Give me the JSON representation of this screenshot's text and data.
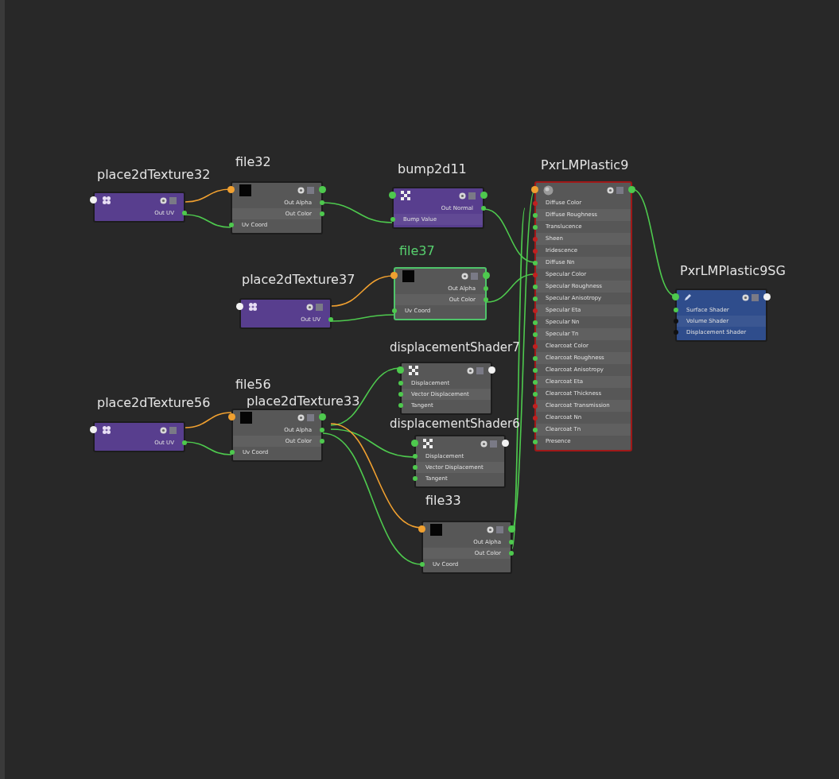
{
  "nodes": [
    {
      "title": "place2dTexture32",
      "kind": "place2d",
      "selected": false,
      "header_ports": [
        {
          "kind": "in",
          "color": "#f2f2f2"
        }
      ],
      "ports": [
        {
          "label": "Out UV",
          "kind": "out",
          "color": "#4ec94e"
        }
      ]
    },
    {
      "title": "file32",
      "kind": "file",
      "selected": false,
      "header_ports": [
        {
          "kind": "in",
          "color": "#f0a030"
        },
        {
          "kind": "out",
          "color": "#4ec94e"
        }
      ],
      "ports": [
        {
          "label": "Out Alpha",
          "kind": "out",
          "color": "#4ec94e"
        },
        {
          "label": "Out Color",
          "kind": "out",
          "color": "#4ec94e"
        },
        {
          "label": "Uv Coord",
          "kind": "in",
          "color": "#4ec94e"
        }
      ]
    },
    {
      "title": "bump2d11",
      "kind": "bump",
      "selected": false,
      "header_ports": [
        {
          "kind": "in",
          "color": "#4ec94e"
        },
        {
          "kind": "out",
          "color": "#4ec94e"
        }
      ],
      "ports": [
        {
          "label": "Out Normal",
          "kind": "out",
          "color": "#4ec94e"
        },
        {
          "label": "Bump Value",
          "kind": "in",
          "color": "#4ec94e"
        }
      ]
    },
    {
      "title": "PxrLMPlastic9",
      "kind": "shader",
      "selected": false,
      "error": true,
      "header_ports": [
        {
          "kind": "in",
          "color": "#f0a030"
        },
        {
          "kind": "out",
          "color": "#4ec94e"
        }
      ],
      "ports": [
        {
          "label": "Diffuse Color",
          "kind": "in",
          "color": "#c02020"
        },
        {
          "label": "Diffuse Roughness",
          "kind": "in",
          "color": "#4ec94e"
        },
        {
          "label": "Translucence",
          "kind": "in",
          "color": "#4ec94e"
        },
        {
          "label": "Sheen",
          "kind": "in",
          "color": "#c02020"
        },
        {
          "label": "Iridescence",
          "kind": "in",
          "color": "#c02020"
        },
        {
          "label": "Diffuse Nn",
          "kind": "in",
          "color": "#4ec94e"
        },
        {
          "label": "Specular Color",
          "kind": "in",
          "color": "#c02020"
        },
        {
          "label": "Specular Roughness",
          "kind": "in",
          "color": "#4ec94e"
        },
        {
          "label": "Specular Anisotropy",
          "kind": "in",
          "color": "#4ec94e"
        },
        {
          "label": "Specular Eta",
          "kind": "in",
          "color": "#c02020"
        },
        {
          "label": "Specular Nn",
          "kind": "in",
          "color": "#4ec94e"
        },
        {
          "label": "Specular Tn",
          "kind": "in",
          "color": "#4ec94e"
        },
        {
          "label": "Clearcoat Color",
          "kind": "in",
          "color": "#c02020"
        },
        {
          "label": "Clearcoat Roughness",
          "kind": "in",
          "color": "#4ec94e"
        },
        {
          "label": "Clearcoat Anisotropy",
          "kind": "in",
          "color": "#4ec94e"
        },
        {
          "label": "Clearcoat Eta",
          "kind": "in",
          "color": "#4ec94e"
        },
        {
          "label": "Clearcoat Thickness",
          "kind": "in",
          "color": "#4ec94e"
        },
        {
          "label": "Clearcoat Transmission",
          "kind": "in",
          "color": "#c02020"
        },
        {
          "label": "Clearcoat Nn",
          "kind": "in",
          "color": "#c02020"
        },
        {
          "label": "Clearcoat Tn",
          "kind": "in",
          "color": "#4ec94e"
        },
        {
          "label": "Presence",
          "kind": "in",
          "color": "#4ec94e"
        }
      ]
    },
    {
      "title": "place2dTexture37",
      "kind": "place2d",
      "selected": false,
      "header_ports": [
        {
          "kind": "in",
          "color": "#f2f2f2"
        }
      ],
      "ports": [
        {
          "label": "Out UV",
          "kind": "out",
          "color": "#4ec94e"
        }
      ]
    },
    {
      "title": "file37",
      "kind": "file",
      "selected": true,
      "header_ports": [
        {
          "kind": "in",
          "color": "#f0a030"
        },
        {
          "kind": "out",
          "color": "#4ec94e"
        }
      ],
      "ports": [
        {
          "label": "Out Alpha",
          "kind": "out",
          "color": "#4ec94e"
        },
        {
          "label": "Out Color",
          "kind": "out",
          "color": "#4ec94e"
        },
        {
          "label": "Uv Coord",
          "kind": "in",
          "color": "#4ec94e"
        }
      ]
    },
    {
      "title": "PxrLMPlastic9SG",
      "kind": "sg",
      "selected": false,
      "header_ports": [
        {
          "kind": "in",
          "color": "#4ec94e"
        },
        {
          "kind": "out",
          "color": "#f2f2f2"
        }
      ],
      "ports": [
        {
          "label": "Surface Shader",
          "kind": "in",
          "color": "#4ec94e"
        },
        {
          "label": "Volume Shader",
          "kind": "in",
          "color": "#111111"
        },
        {
          "label": "Displacement Shader",
          "kind": "in",
          "color": "#111111"
        }
      ]
    },
    {
      "title": "displacementShader7",
      "kind": "displacement",
      "selected": false,
      "header_ports": [
        {
          "kind": "in",
          "color": "#4ec94e"
        },
        {
          "kind": "out",
          "color": "#f2f2f2"
        }
      ],
      "ports": [
        {
          "label": "Displacement",
          "kind": "in",
          "color": "#4ec94e"
        },
        {
          "label": "Vector Displacement",
          "kind": "in",
          "color": "#4ec94e"
        },
        {
          "label": "Tangent",
          "kind": "in",
          "color": "#4ec94e"
        }
      ]
    },
    {
      "title": "place2dTexture56",
      "kind": "place2d",
      "selected": false,
      "header_ports": [
        {
          "kind": "in",
          "color": "#f2f2f2"
        }
      ],
      "ports": [
        {
          "label": "Out UV",
          "kind": "out",
          "color": "#4ec94e"
        }
      ]
    },
    {
      "title": "file56",
      "kind": "file",
      "selected": false,
      "header_ports": [
        {
          "kind": "in",
          "color": "#f0a030"
        },
        {
          "kind": "out",
          "color": "#4ec94e"
        }
      ],
      "ports": [
        {
          "label": "Out Alpha",
          "kind": "out",
          "color": "#4ec94e"
        },
        {
          "label": "Out Color",
          "kind": "out",
          "color": "#4ec94e"
        },
        {
          "label": "Uv Coord",
          "kind": "in",
          "color": "#4ec94e"
        }
      ]
    },
    {
      "title": "place2dTexture33",
      "kind": "label",
      "selected": false
    },
    {
      "title": "displacementShader6",
      "kind": "displacement",
      "selected": false,
      "header_ports": [
        {
          "kind": "in",
          "color": "#4ec94e"
        },
        {
          "kind": "out",
          "color": "#f2f2f2"
        }
      ],
      "ports": [
        {
          "label": "Displacement",
          "kind": "in",
          "color": "#4ec94e"
        },
        {
          "label": "Vector Displacement",
          "kind": "in",
          "color": "#4ec94e"
        },
        {
          "label": "Tangent",
          "kind": "in",
          "color": "#4ec94e"
        }
      ]
    },
    {
      "title": "file33",
      "kind": "file",
      "selected": false,
      "header_ports": [
        {
          "kind": "in",
          "color": "#f0a030"
        },
        {
          "kind": "out",
          "color": "#4ec94e"
        }
      ],
      "ports": [
        {
          "label": "Out Alpha",
          "kind": "out",
          "color": "#4ec94e"
        },
        {
          "label": "Out Color",
          "kind": "out",
          "color": "#4ec94e"
        },
        {
          "label": "Uv Coord",
          "kind": "in",
          "color": "#4ec94e"
        }
      ]
    }
  ]
}
